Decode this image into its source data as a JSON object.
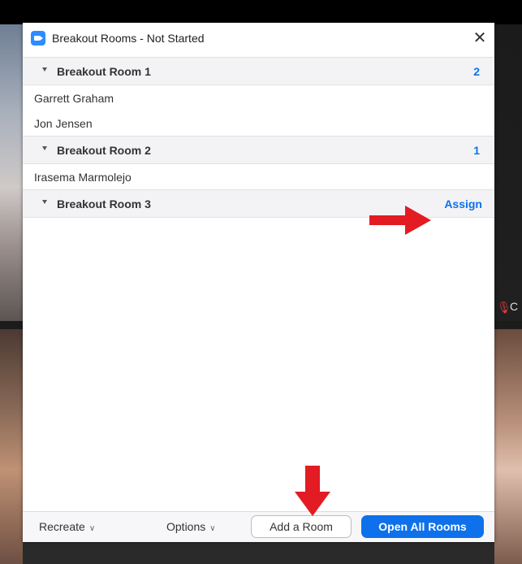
{
  "window": {
    "title": "Breakout Rooms - Not Started",
    "close_glyph": "✕"
  },
  "rooms": [
    {
      "name": "Breakout Room 1",
      "count": "2",
      "participants": [
        "Garrett Graham",
        "Jon Jensen"
      ]
    },
    {
      "name": "Breakout Room 2",
      "count": "1",
      "participants": [
        "Irasema Marmolejo"
      ]
    },
    {
      "name": "Breakout Room 3",
      "action": "Assign",
      "participants": []
    }
  ],
  "footer": {
    "recreate_label": "Recreate",
    "options_label": "Options",
    "add_room_label": "Add a Room",
    "open_all_label": "Open All Rooms"
  },
  "background": {
    "mic_label": "C"
  },
  "colors": {
    "accent": "#0e71eb",
    "annotation_arrow": "#e31b23"
  }
}
